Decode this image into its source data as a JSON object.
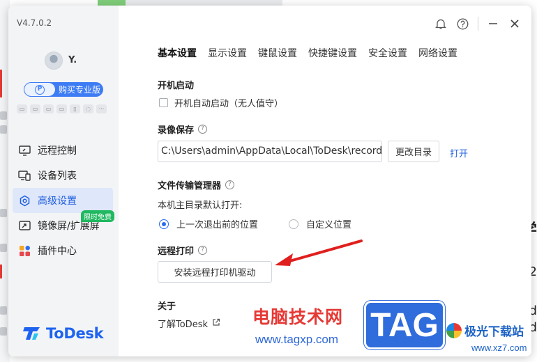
{
  "window": {
    "version": "V4.7.0.2",
    "username": "Y.",
    "buy_label": "购买专业版"
  },
  "sidebar": {
    "items": [
      {
        "label": "远程控制",
        "icon": "monitor-icon",
        "active": false
      },
      {
        "label": "设备列表",
        "icon": "devices-icon",
        "active": false
      },
      {
        "label": "高级设置",
        "icon": "settings-icon",
        "active": true
      },
      {
        "label": "镜像屏/扩展屏",
        "icon": "mirror-icon",
        "active": false,
        "badge": "限时免费"
      },
      {
        "label": "插件中心",
        "icon": "plugins-icon",
        "active": false
      }
    ],
    "logo_text": "ToDesk"
  },
  "tabs": [
    "基本设置",
    "显示设置",
    "键鼠设置",
    "快捷键设置",
    "安全设置",
    "网络设置"
  ],
  "settings": {
    "startup": {
      "title": "开机启动",
      "checkbox_label": "开机自动启动（无人值守）",
      "checked": false
    },
    "recording": {
      "title": "录像保存",
      "path": "C:\\Users\\admin\\AppData\\Local\\ToDesk\\record",
      "change_button": "更改目录",
      "open_link": "打开"
    },
    "file_transfer": {
      "title": "文件传输管理器",
      "sub_label": "本机主目录默认打开:",
      "options": [
        {
          "label": "上一次退出前的位置",
          "selected": true
        },
        {
          "label": "自定义位置",
          "selected": false
        }
      ]
    },
    "remote_print": {
      "title": "远程打印",
      "install_button": "安装远程打印机驱动"
    },
    "about": {
      "title": "关于",
      "link": "了解ToDesk"
    }
  },
  "watermark": {
    "text": "电脑技术网",
    "url": "www.tagxp.com",
    "tag": "TAG",
    "site_cn": "极光下载站",
    "site_url": "www.xz7.com"
  },
  "colors": {
    "accent": "#1f5fe0",
    "sidebar_bg": "#f3f4f6",
    "active_bg": "#dfe7fa",
    "badge_green": "#20b860"
  }
}
